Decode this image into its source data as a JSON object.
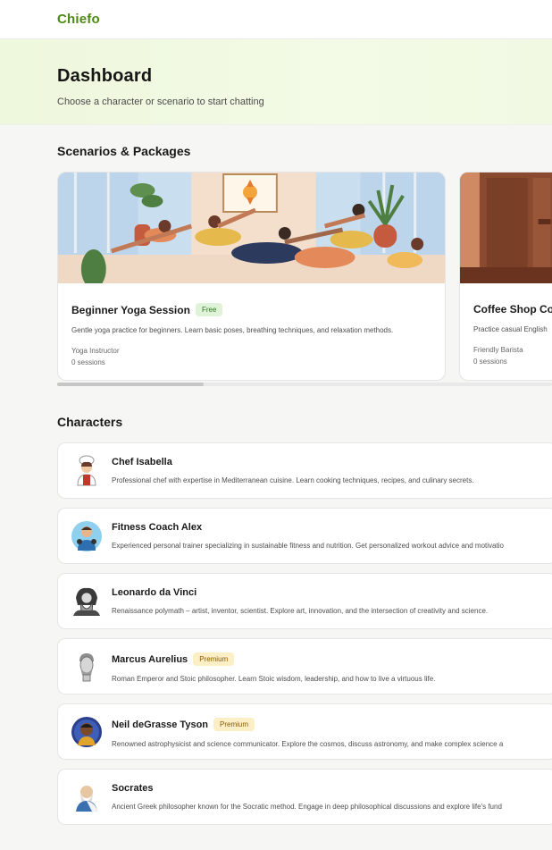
{
  "app": {
    "logo": "Chiefo"
  },
  "hero": {
    "title": "Dashboard",
    "subtitle": "Choose a character or scenario to start chatting"
  },
  "scenarios": {
    "title": "Scenarios & Packages",
    "items": [
      {
        "title": "Beginner Yoga Session",
        "badge": "Free",
        "desc": "Gentle yoga practice for beginners. Learn basic poses, breathing techniques, and relaxation methods.",
        "role": "Yoga Instructor",
        "sessions": "0 sessions"
      },
      {
        "title": "Coffee Shop Co",
        "desc": "Practice casual English",
        "role": "Friendly Barista",
        "sessions": "0 sessions"
      }
    ]
  },
  "characters": {
    "title": "Characters",
    "items": [
      {
        "name": "Chef Isabella",
        "desc": "Professional chef with expertise in Mediterranean cuisine. Learn cooking techniques, recipes, and culinary secrets."
      },
      {
        "name": "Fitness Coach Alex",
        "desc": "Experienced personal trainer specializing in sustainable fitness and nutrition. Get personalized workout advice and motivatio"
      },
      {
        "name": "Leonardo da Vinci",
        "desc": "Renaissance polymath – artist, inventor, scientist. Explore art, innovation, and the intersection of creativity and science."
      },
      {
        "name": "Marcus Aurelius",
        "badge": "Premium",
        "desc": "Roman Emperor and Stoic philosopher. Learn Stoic wisdom, leadership, and how to live a virtuous life."
      },
      {
        "name": "Neil deGrasse Tyson",
        "badge": "Premium",
        "desc": "Renowned astrophysicist and science communicator. Explore the cosmos, discuss astronomy, and make complex science a"
      },
      {
        "name": "Socrates",
        "desc": "Ancient Greek philosopher known for the Socratic method. Engage in deep philosophical discussions and explore life's fund"
      }
    ]
  }
}
